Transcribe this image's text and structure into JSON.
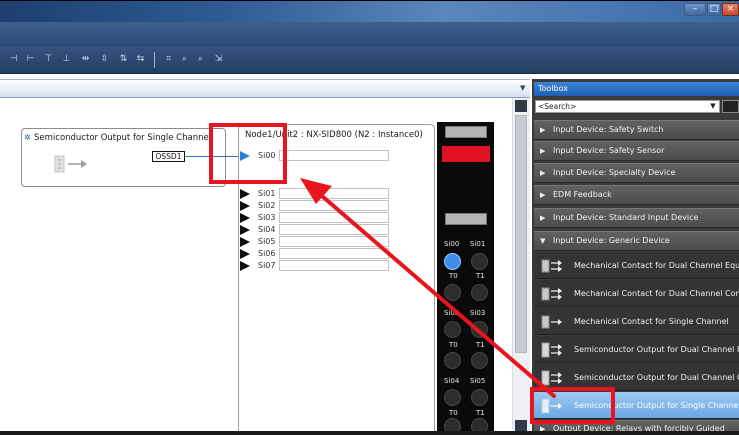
{
  "toolbox": {
    "title": "Toolbox",
    "search_placeholder": "<Search>",
    "categories": [
      {
        "label": "Input Device: Safety Switch"
      },
      {
        "label": "Input Device: Safety Sensor"
      },
      {
        "label": "Input Device: Specialty Device"
      },
      {
        "label": "EDM Feedback"
      },
      {
        "label": "Input Device: Standard Input Device"
      },
      {
        "label": "Input Device: Generic Device"
      }
    ],
    "items": [
      {
        "label": "Mechanical Contact for Dual Channel Equ"
      },
      {
        "label": "Mechanical Contact for Dual Channel Com"
      },
      {
        "label": "Mechanical Contact for Single Channel"
      },
      {
        "label": "Semiconductor Output for Dual Channel F"
      },
      {
        "label": "Semiconductor Output for Dual Channel C"
      },
      {
        "label": "Semiconductor Output for Single Channel"
      }
    ],
    "last_category": {
      "label": "Output Device: Relays with forcibly Guided"
    }
  },
  "editor": {
    "device": {
      "title": "Semiconductor Output for Single Channel",
      "output": "OSSD1"
    },
    "node": {
      "title": "Node1/Unit2 : NX-SID800 (N2 : Instance0)",
      "ports": [
        "Si00",
        "Si01",
        "Si02",
        "Si03",
        "Si04",
        "Si05",
        "Si06",
        "Si07"
      ]
    },
    "terminal": {
      "pairs": [
        {
          "left": "Si00",
          "right": "Si01"
        },
        {
          "left": "T0",
          "right": "T1"
        },
        {
          "left": "Si02",
          "right": "Si03"
        },
        {
          "left": "T0",
          "right": "T1"
        },
        {
          "left": "Si04",
          "right": "Si05"
        },
        {
          "left": "T0",
          "right": "T1"
        }
      ]
    }
  },
  "colors": {
    "highlight": "#e8141e",
    "selection": "#6aa8e3",
    "toolbox_header": "#1f5fb0"
  }
}
